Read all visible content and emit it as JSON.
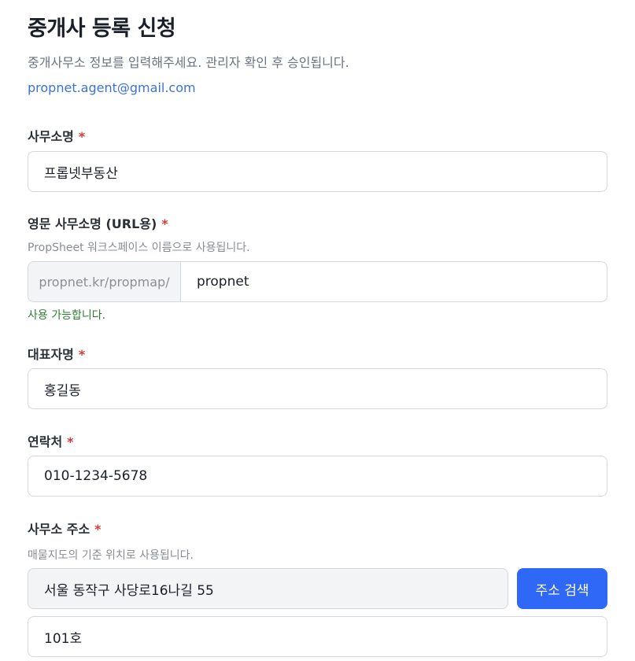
{
  "header": {
    "title": "중개사 등록 신청",
    "subtitle": "중개사무소 정보를 입력해주세요. 관리자 확인 후 승인됩니다.",
    "email": "propnet.agent@gmail.com"
  },
  "required_mark": "*",
  "form": {
    "office_name": {
      "label": "사무소명",
      "value": "프롭넷부동산"
    },
    "office_slug": {
      "label": "영문 사무소명 (URL용)",
      "help": "PropSheet 워크스페이스 이름으로 사용됩니다.",
      "prefix": "propnet.kr/propmap/",
      "value": "propnet",
      "status": "사용 가능합니다."
    },
    "representative": {
      "label": "대표자명",
      "value": "홍길동"
    },
    "contact": {
      "label": "연락처",
      "value": "010-1234-5678"
    },
    "address": {
      "label": "사무소 주소",
      "help": "매물지도의 기준 위치로 사용됩니다.",
      "value": "서울 동작구 사당로16나길 55",
      "search_button": "주소 검색",
      "detail_value": "101호"
    }
  },
  "colors": {
    "accent": "#2f67f6",
    "link": "#3b72d9",
    "required": "#d93a3a",
    "success": "#2e7d32",
    "border": "#d4d7dc",
    "readonly_bg": "#f3f4f6"
  }
}
